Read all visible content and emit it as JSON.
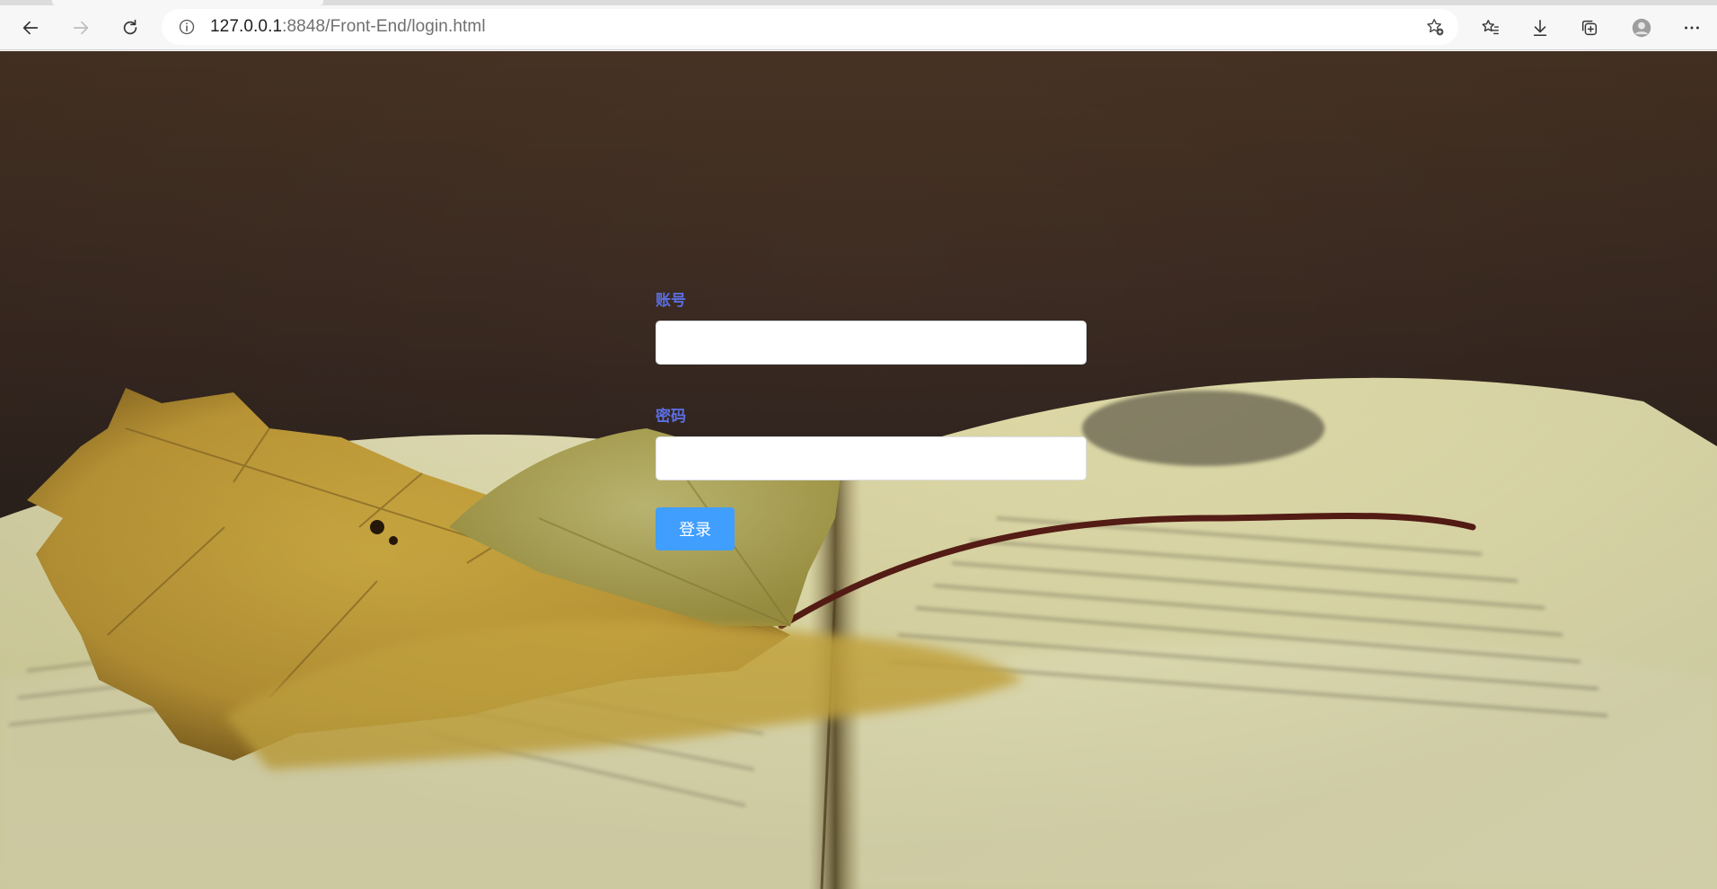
{
  "browser": {
    "url_host": "127.0.0.1",
    "url_rest": ":8848/Front-End/login.html",
    "icons": {
      "back": "back-arrow-icon",
      "forward": "forward-arrow-icon",
      "refresh": "refresh-icon",
      "site_info": "info-icon",
      "add_favorite": "star-plus-icon",
      "favorites": "favorites-list-icon",
      "downloads": "download-icon",
      "collections": "collections-icon",
      "profile": "profile-avatar-icon",
      "menu": "more-menu-icon"
    }
  },
  "form": {
    "account_label": "账号",
    "account_value": "",
    "password_label": "密码",
    "password_value": "",
    "submit_label": "登录"
  },
  "colors": {
    "label": "#5b6ee1",
    "button": "#409eff",
    "chrome": "#f7f7f7"
  }
}
